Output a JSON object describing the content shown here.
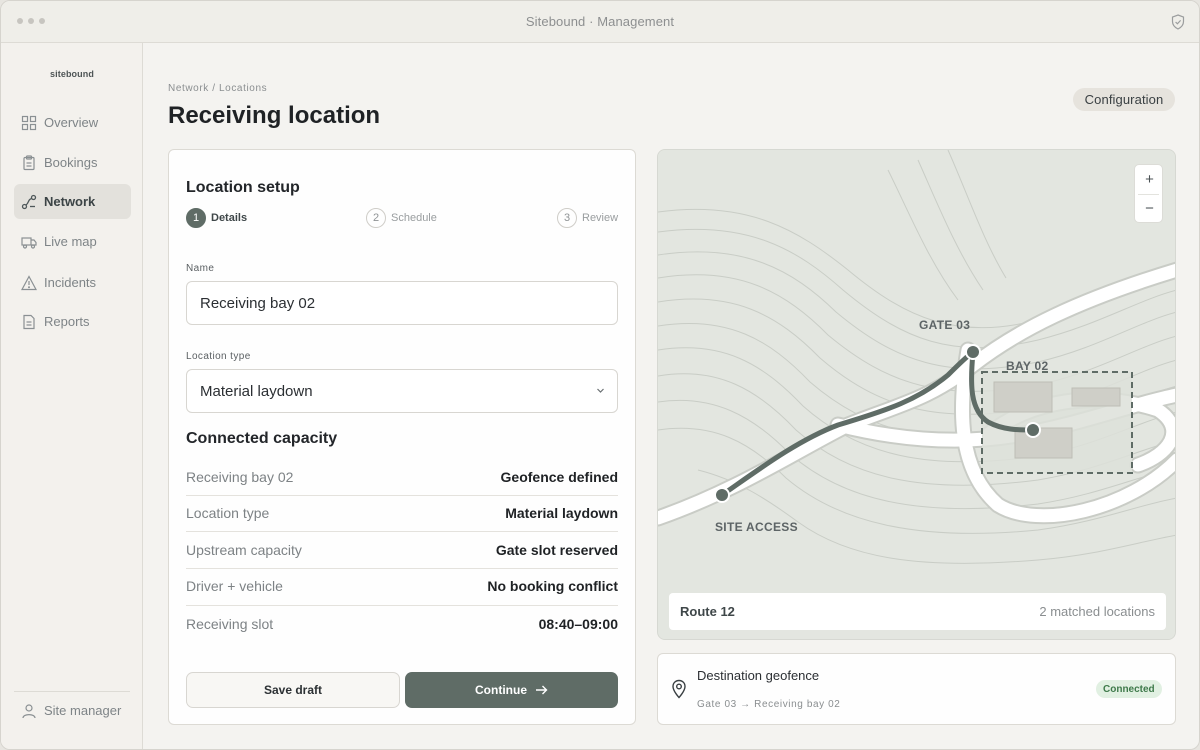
{
  "window": {
    "title": "Sitebound · Management"
  },
  "sidebar": {
    "brand": "sitebound",
    "items": [
      {
        "label": "Overview",
        "icon": "grid-icon",
        "active": false
      },
      {
        "label": "Bookings",
        "icon": "clipboard-icon",
        "active": false
      },
      {
        "label": "Network",
        "icon": "network-icon",
        "active": true
      },
      {
        "label": "Live map",
        "icon": "truck-icon",
        "active": false
      },
      {
        "label": "Incidents",
        "icon": "warning-icon",
        "active": false
      },
      {
        "label": "Reports",
        "icon": "document-icon",
        "active": false
      }
    ],
    "user": {
      "label": "Site manager",
      "icon": "user-icon"
    }
  },
  "header": {
    "breadcrumb": "Network / Locations",
    "title": "Receiving location",
    "config_label": "Configuration"
  },
  "form": {
    "title": "Location setup",
    "steps": [
      {
        "num": "1",
        "label": "Details",
        "active": true
      },
      {
        "num": "2",
        "label": "Schedule",
        "active": false
      },
      {
        "num": "3",
        "label": "Review",
        "active": false
      }
    ],
    "name_label": "Name",
    "name_value": "Receiving bay 02",
    "type_label": "Location type",
    "type_value": "Material laydown",
    "capacity_title": "Connected capacity",
    "capacity_rows": [
      {
        "key": "Receiving bay 02",
        "value": "Geofence defined"
      },
      {
        "key": "Location type",
        "value": "Material laydown"
      },
      {
        "key": "Upstream capacity",
        "value": "Gate slot reserved"
      },
      {
        "key": "Driver + vehicle",
        "value": "No booking conflict"
      },
      {
        "key": "Receiving slot",
        "value": "08:40–09:00"
      }
    ],
    "save_label": "Save draft",
    "continue_label": "Continue"
  },
  "map": {
    "labels": {
      "gate": "GATE 03",
      "bay": "BAY 02",
      "access": "SITE ACCESS"
    },
    "zoom_in": "+",
    "zoom_out": "−",
    "route_name": "Route 12",
    "route_count": "2 matched locations",
    "colors": {
      "route": "#5f6c66",
      "land": "#e3e6e0",
      "road": "#ffffff"
    }
  },
  "destination": {
    "title": "Destination geofence",
    "subtitle": "Gate 03 → Receiving bay 02",
    "status": "Connected"
  }
}
